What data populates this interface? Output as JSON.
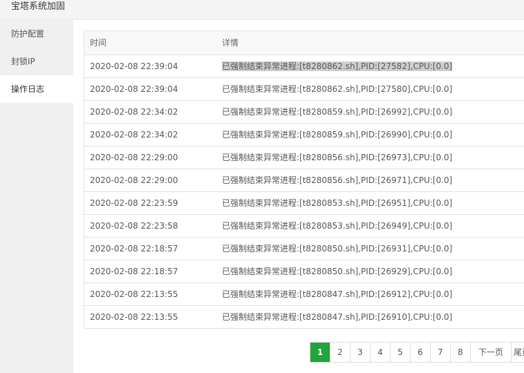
{
  "window": {
    "title": "宝塔系统加固"
  },
  "sidebar": {
    "items": [
      {
        "label": "防护配置",
        "active": false
      },
      {
        "label": "封锁IP",
        "active": false
      },
      {
        "label": "操作日志",
        "active": true
      }
    ]
  },
  "log_table": {
    "columns": [
      "时间",
      "详情"
    ],
    "rows": [
      {
        "time": "2020-02-08 22:39:04",
        "detail": "已强制结束异常进程:[t8280862.sh],PID:[27582],CPU:[0.0]"
      },
      {
        "time": "2020-02-08 22:39:04",
        "detail": "已强制结束异常进程:[t8280862.sh],PID:[27580],CPU:[0.0]"
      },
      {
        "time": "2020-02-08 22:34:02",
        "detail": "已强制结束异常进程:[t8280859.sh],PID:[26992],CPU:[0.0]"
      },
      {
        "time": "2020-02-08 22:34:02",
        "detail": "已强制结束异常进程:[t8280859.sh],PID:[26990],CPU:[0.0]"
      },
      {
        "time": "2020-02-08 22:29:00",
        "detail": "已强制结束异常进程:[t8280856.sh],PID:[26973],CPU:[0.0]"
      },
      {
        "time": "2020-02-08 22:29:00",
        "detail": "已强制结束异常进程:[t8280856.sh],PID:[26971],CPU:[0.0]"
      },
      {
        "time": "2020-02-08 22:23:59",
        "detail": "已强制结束异常进程:[t8280853.sh],PID:[26951],CPU:[0.0]"
      },
      {
        "time": "2020-02-08 22:23:58",
        "detail": "已强制结束异常进程:[t8280853.sh],PID:[26949],CPU:[0.0]"
      },
      {
        "time": "2020-02-08 22:18:57",
        "detail": "已强制结束异常进程:[t8280850.sh],PID:[26931],CPU:[0.0]"
      },
      {
        "time": "2020-02-08 22:18:57",
        "detail": "已强制结束异常进程:[t8280850.sh],PID:[26929],CPU:[0.0]"
      },
      {
        "time": "2020-02-08 22:13:55",
        "detail": "已强制结束异常进程:[t8280847.sh],PID:[26912],CPU:[0.0]"
      },
      {
        "time": "2020-02-08 22:13:55",
        "detail": "已强制结束异常进程:[t8280847.sh],PID:[26910],CPU:[0.0]"
      }
    ]
  },
  "pagination": {
    "pages": [
      "1",
      "2",
      "3",
      "4",
      "5",
      "6",
      "7",
      "8"
    ],
    "current": "1",
    "next_label": "下一页",
    "last_label": "尾页",
    "accent_color": "#20a53a"
  }
}
